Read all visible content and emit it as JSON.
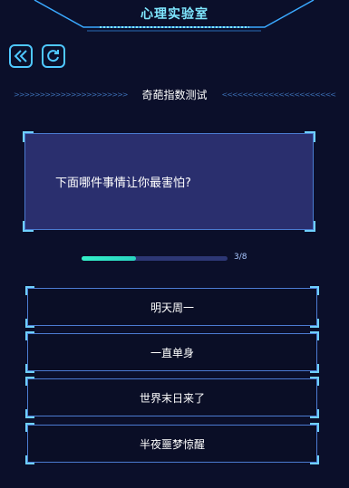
{
  "header": {
    "title": "心理实验室"
  },
  "toolbar": {
    "back_icon": "double-chevron-left-icon",
    "refresh_icon": "refresh-icon"
  },
  "quiz": {
    "name": "奇葩指数测试",
    "question": "下面哪件事情让你最害怕?",
    "progress": {
      "current": 3,
      "total": 8,
      "label": "3/8"
    },
    "options": [
      "明天周一",
      "一直单身",
      "世界末日来了",
      "半夜噩梦惊醒"
    ]
  },
  "colors": {
    "background": "#0b0f2a",
    "accent": "#4fc8ff",
    "title": "#7fe7ff",
    "progress": "#34f0c8",
    "card": "#2a2f6e"
  }
}
